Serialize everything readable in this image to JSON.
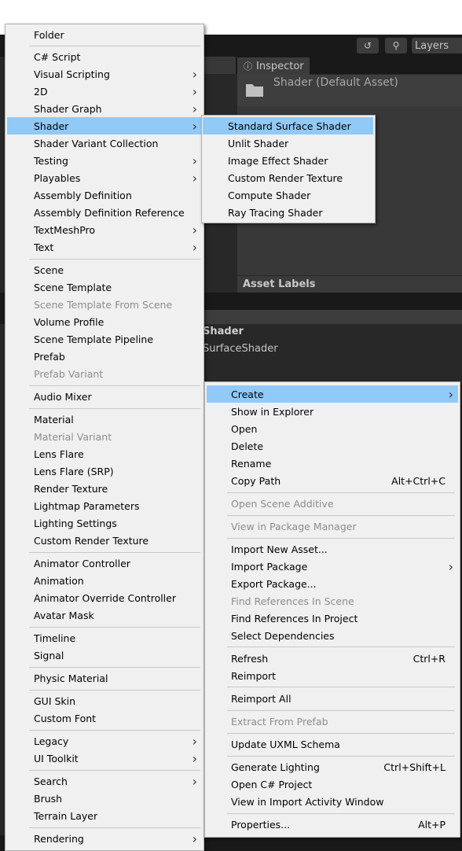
{
  "toolbar": {
    "layers_label": "Layers"
  },
  "inspector": {
    "tab_label": "Inspector",
    "title": "Shader (Default Asset)",
    "asset_labels": "Asset Labels"
  },
  "project": {
    "header": "Shader",
    "sub": "SurfaceShader"
  },
  "create_menu": {
    "items": [
      {
        "label": "Folder"
      },
      {
        "label": "C# Script"
      },
      {
        "label": "Visual Scripting",
        "submenu": true
      },
      {
        "label": "2D",
        "submenu": true
      },
      {
        "label": "Shader Graph",
        "submenu": true
      },
      {
        "label": "Shader",
        "submenu": true,
        "highlighted": true
      },
      {
        "label": "Shader Variant Collection"
      },
      {
        "label": "Testing",
        "submenu": true
      },
      {
        "label": "Playables",
        "submenu": true
      },
      {
        "label": "Assembly Definition"
      },
      {
        "label": "Assembly Definition Reference"
      },
      {
        "label": "TextMeshPro",
        "submenu": true
      },
      {
        "label": "Text",
        "submenu": true
      },
      {
        "label": "Scene"
      },
      {
        "label": "Scene Template"
      },
      {
        "label": "Scene Template From Scene",
        "disabled": true
      },
      {
        "label": "Volume Profile"
      },
      {
        "label": "Scene Template Pipeline"
      },
      {
        "label": "Prefab"
      },
      {
        "label": "Prefab Variant",
        "disabled": true
      },
      {
        "label": "Audio Mixer"
      },
      {
        "label": "Material"
      },
      {
        "label": "Material Variant",
        "disabled": true
      },
      {
        "label": "Lens Flare"
      },
      {
        "label": "Lens Flare (SRP)"
      },
      {
        "label": "Render Texture"
      },
      {
        "label": "Lightmap Parameters"
      },
      {
        "label": "Lighting Settings"
      },
      {
        "label": "Custom Render Texture"
      },
      {
        "label": "Animator Controller"
      },
      {
        "label": "Animation"
      },
      {
        "label": "Animator Override Controller"
      },
      {
        "label": "Avatar Mask"
      },
      {
        "label": "Timeline"
      },
      {
        "label": "Signal"
      },
      {
        "label": "Physic Material"
      },
      {
        "label": "GUI Skin"
      },
      {
        "label": "Custom Font"
      },
      {
        "label": "Legacy",
        "submenu": true
      },
      {
        "label": "UI Toolkit",
        "submenu": true
      },
      {
        "label": "Search",
        "submenu": true
      },
      {
        "label": "Brush"
      },
      {
        "label": "Terrain Layer"
      },
      {
        "label": "Rendering",
        "submenu": true
      }
    ]
  },
  "shader_menu": {
    "items": [
      {
        "label": "Standard Surface Shader",
        "highlighted": true
      },
      {
        "label": "Unlit Shader"
      },
      {
        "label": "Image Effect Shader"
      },
      {
        "label": "Custom Render Texture"
      },
      {
        "label": "Compute Shader"
      },
      {
        "label": "Ray Tracing Shader"
      }
    ]
  },
  "context_menu": {
    "items": [
      {
        "label": "Create",
        "submenu": true,
        "highlighted": true
      },
      {
        "label": "Show in Explorer"
      },
      {
        "label": "Open"
      },
      {
        "label": "Delete"
      },
      {
        "label": "Rename"
      },
      {
        "label": "Copy Path",
        "shortcut": "Alt+Ctrl+C"
      },
      {
        "label": "Open Scene Additive",
        "disabled": true
      },
      {
        "label": "View in Package Manager",
        "disabled": true
      },
      {
        "label": "Import New Asset..."
      },
      {
        "label": "Import Package",
        "submenu": true
      },
      {
        "label": "Export Package..."
      },
      {
        "label": "Find References In Scene",
        "disabled": true
      },
      {
        "label": "Find References In Project"
      },
      {
        "label": "Select Dependencies"
      },
      {
        "label": "Refresh",
        "shortcut": "Ctrl+R"
      },
      {
        "label": "Reimport"
      },
      {
        "label": "Reimport All"
      },
      {
        "label": "Extract From Prefab",
        "disabled": true
      },
      {
        "label": "Update UXML Schema"
      },
      {
        "label": "Generate Lighting",
        "shortcut": "Ctrl+Shift+L"
      },
      {
        "label": "Open C# Project"
      },
      {
        "label": "View in Import Activity Window"
      },
      {
        "label": "Properties...",
        "shortcut": "Alt+P"
      }
    ]
  }
}
